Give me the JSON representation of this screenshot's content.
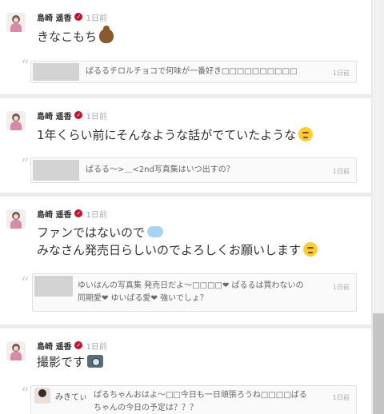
{
  "posts": [
    {
      "author": "島崎 遥香",
      "time": "1日前",
      "lines": [
        "きなこもち"
      ],
      "emojis": [
        "poop-emoji"
      ],
      "reply": {
        "text": "ぱるるチロルチョコで何味が一番好き□□□□□□□□□□",
        "time": "1日前"
      }
    },
    {
      "author": "島崎 遥香",
      "time": "1日前",
      "lines": [
        "1年くらい前にそんなような話がでていたような"
      ],
      "emojis": [
        "sleepy-face-emoji"
      ],
      "reply": {
        "text": "ぱるる〜>＿<2nd写真集はいつ出すの？",
        "time": "1日前"
      }
    },
    {
      "author": "島崎 遥香",
      "time": "1日前",
      "lines": [
        "ファンではないので",
        "みなさん発売日らしいのでよろしくお願いします"
      ],
      "emojis": [
        "dash-emoji",
        "sleepy-face-emoji"
      ],
      "reply": {
        "line1": "ゆいはんの写真集 発売日だよ〜□□□□❤ ぱるるは買わないの",
        "line2": "同期愛❤ ゆいぱる愛❤ 強いでしょ？",
        "time": "1日前"
      }
    },
    {
      "author": "島崎 遥香",
      "time": "1日前",
      "lines": [
        "撮影です"
      ],
      "emojis": [
        "camera-emoji"
      ],
      "reply": {
        "user": "みきてぃ",
        "line1": "ぱるちゃんおはよ〜□□今日も一日頑張ろうね□□□□ぱる",
        "line2": "ちゃんの今日の予定は？？？",
        "time": "1日前"
      }
    }
  ],
  "ui": {
    "verified_glyph": "✓",
    "quote_glyph": "“"
  }
}
